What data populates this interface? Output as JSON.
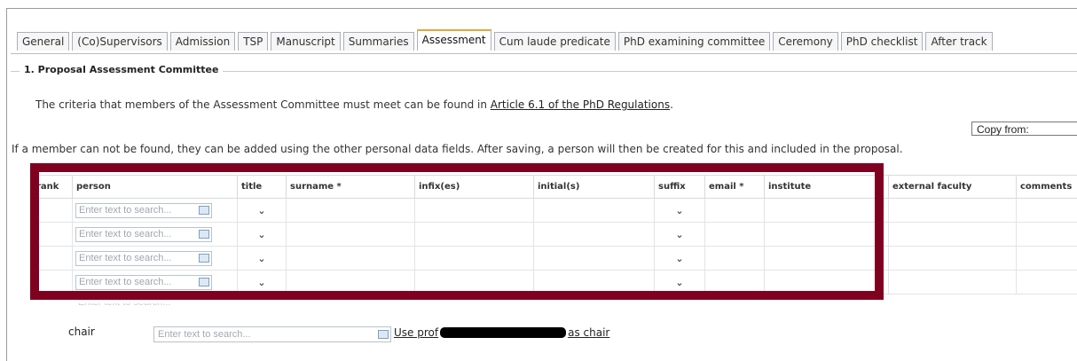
{
  "tabs": [
    "General",
    "(Co)Supervisors",
    "Admission",
    "TSP",
    "Manuscript",
    "Summaries",
    "Assessment",
    "Cum laude predicate",
    "PhD examining committee",
    "Ceremony",
    "PhD checklist",
    "After track"
  ],
  "active_tab": "Assessment",
  "section": {
    "legend": "1. Proposal Assessment Committee"
  },
  "intro": {
    "prefix": "The criteria that members of the Assessment Committee must meet can be found in ",
    "link": "Article 6.1 of the PhD Regulations",
    "suffix": "."
  },
  "copy_from": "Copy from:",
  "note": "If a member can not be found, they can be added using the other personal data fields. After saving, a person will then be created for this and included in the proposal.",
  "table": {
    "headers": [
      "rank",
      "person",
      "title",
      "surname *",
      "infix(es)",
      "initial(s)",
      "suffix",
      "email *",
      "institute",
      "external faculty",
      "comments"
    ],
    "placeholder": "Enter text to search...",
    "rows": 4,
    "chevron": "⌄"
  },
  "chair": {
    "label": "chair",
    "placeholder": "Enter text to search...",
    "link_prefix": "Use prof",
    "link_suffix": "as chair"
  },
  "colors": {
    "highlight": "#800020",
    "active_tab_accent": "#e5a73b"
  }
}
